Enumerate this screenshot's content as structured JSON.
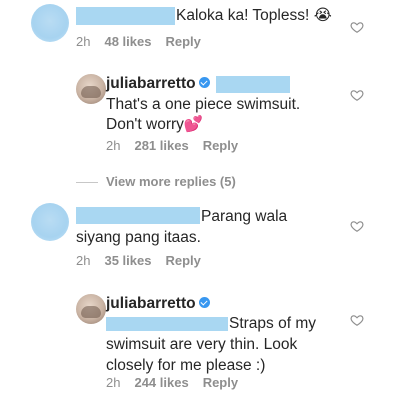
{
  "comments": [
    {
      "text": "Kaloka ka! Topless!",
      "emoji": "😭",
      "time": "2h",
      "likes": "48 likes",
      "reply": "Reply"
    },
    {
      "username": "juliabarretto",
      "line1": "That's a one piece swimsuit.",
      "line2": "Don't worry",
      "emoji": "💕",
      "time": "2h",
      "likes": "281 likes",
      "reply": "Reply"
    },
    {
      "text": "Parang wala",
      "line2": "siyang pang itaas.",
      "time": "2h",
      "likes": "35 likes",
      "reply": "Reply"
    },
    {
      "username": "juliabarretto",
      "line1": "Straps of my",
      "line2": "swimsuit are very thin. Look",
      "line3": "closely for me please :)",
      "time": "2h",
      "likes": "244 likes",
      "reply": "Reply"
    }
  ],
  "view_more": "View more replies (5)",
  "colors": {
    "redaction": "#a9d7f2",
    "meta": "#8e8e8e",
    "verified": "#3897f0"
  }
}
